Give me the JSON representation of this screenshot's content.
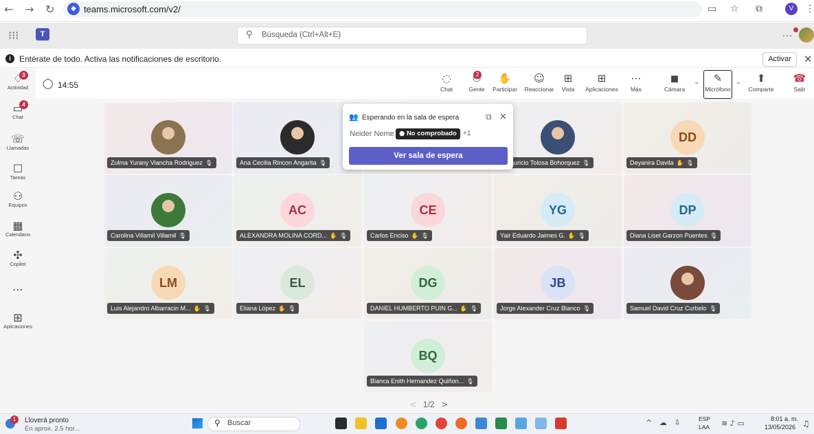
{
  "browser": {
    "url": "teams.microsoft.com/v2/",
    "profile_initial": "V"
  },
  "header": {
    "search_placeholder": "Búsqueda (Ctrl+Alt+E)"
  },
  "notification": {
    "text": "Entérate de todo. Activa las notificaciones de escritorio.",
    "button_label": "Activar"
  },
  "rail": {
    "items": [
      {
        "label": "Actividad",
        "icon": "bell-icon",
        "badge": "3"
      },
      {
        "label": "Chat",
        "icon": "chat-icon",
        "badge": "4"
      },
      {
        "label": "Llamadas",
        "icon": "phone-icon",
        "badge": ""
      },
      {
        "label": "Tareas",
        "icon": "tasks-icon",
        "badge": ""
      },
      {
        "label": "Equipos",
        "icon": "teams-icon",
        "badge": ""
      },
      {
        "label": "Calendario",
        "icon": "calendar-icon",
        "badge": ""
      },
      {
        "label": "Copilot",
        "icon": "copilot-icon",
        "badge": ""
      },
      {
        "label": "",
        "icon": "more-icon",
        "badge": ""
      },
      {
        "label": "Aplicaciones",
        "icon": "add-apps-icon",
        "badge": ""
      }
    ]
  },
  "meeting": {
    "timer": "14:55",
    "toolbar": [
      {
        "label": "Chat",
        "icon": "chat-bubble-icon"
      },
      {
        "label": "Gente",
        "icon": "people-icon",
        "badge": "2"
      },
      {
        "label": "Participar",
        "icon": "raise-hand-icon"
      },
      {
        "label": "Reaccionar",
        "icon": "smile-icon"
      },
      {
        "label": "Vista",
        "icon": "grid-view-icon"
      },
      {
        "label": "Aplicaciones",
        "icon": "add-app-icon"
      },
      {
        "label": "Más",
        "icon": "more-horizontal-icon"
      },
      {
        "label": "Cámara",
        "icon": "camera-off-icon"
      },
      {
        "label": "Micrófono",
        "icon": "mic-off-icon"
      },
      {
        "label": "Comparte",
        "icon": "share-screen-icon"
      },
      {
        "label": "Salir",
        "icon": "hang-up-icon"
      }
    ]
  },
  "participants": [
    {
      "name": "Zulma Yurany Viancha Rodriguez",
      "initials": "",
      "photo": true,
      "hand": false,
      "color": "#8a7350"
    },
    {
      "name": "Ana Cecilia Rincon Angarita",
      "initials": "",
      "photo": true,
      "hand": false,
      "color": "#2b2b2b"
    },
    {
      "name": "",
      "initials": "",
      "photo": false,
      "hand": false,
      "color": ""
    },
    {
      "name": "o Mauricio Tolosa Bohorquez",
      "initials": "",
      "photo": true,
      "hand": false,
      "color": "#3b4f74"
    },
    {
      "name": "Deyanira Davila",
      "initials": "DD",
      "photo": false,
      "hand": true,
      "color": "#f7d9b5",
      "text": "#8a4b1c"
    },
    {
      "name": "Carolina Villamil Villamil",
      "initials": "",
      "photo": true,
      "hand": false,
      "color": "#3d7a3a"
    },
    {
      "name": "ALEXANDRA MOLINA CORD...",
      "initials": "AC",
      "photo": false,
      "hand": true,
      "color": "#fbd7dc",
      "text": "#a8323f"
    },
    {
      "name": "Carlos Enciso",
      "initials": "CE",
      "photo": false,
      "hand": true,
      "color": "#fbd7dc",
      "text": "#a8323f"
    },
    {
      "name": "Yair Eduardo Jaimes G.",
      "initials": "YG",
      "photo": false,
      "hand": true,
      "color": "#d5ecf6",
      "text": "#226a8a"
    },
    {
      "name": "Diana Liset Garzon Puentes",
      "initials": "DP",
      "photo": false,
      "hand": false,
      "color": "#d5ecf6",
      "text": "#226a8a"
    },
    {
      "name": "Luis Alejandro Albarracin M...",
      "initials": "LM",
      "photo": false,
      "hand": true,
      "color": "#f7d9b5",
      "text": "#8a4b1c"
    },
    {
      "name": "Eliana López",
      "initials": "EL",
      "photo": false,
      "hand": true,
      "color": "#dbe9dd",
      "text": "#3e5b44"
    },
    {
      "name": "DANIEL HUMBERTO PUIN G...",
      "initials": "DG",
      "photo": false,
      "hand": true,
      "color": "#d3eed7",
      "text": "#2e6b3a"
    },
    {
      "name": "Jorge Alexander Cruz Blanco",
      "initials": "JB",
      "photo": false,
      "hand": false,
      "color": "#d9e3f5",
      "text": "#2d4d86"
    },
    {
      "name": "Samuel David Cruz Curbelo",
      "initials": "",
      "photo": true,
      "hand": false,
      "color": "#7a4b3a"
    },
    {
      "name": "Blanca Enith Hernandez Quiñon...",
      "initials": "BQ",
      "photo": false,
      "hand": false,
      "color": "#d3eed7",
      "text": "#2e6b3a"
    }
  ],
  "lobby": {
    "title": "Esperando en la sala de espera",
    "person": "Neider Neme",
    "badge": "No comprobado",
    "extra": "+1",
    "button": "Ver sala de espera"
  },
  "pager": {
    "text": "1/2"
  },
  "taskbar": {
    "weather_title": "Lloverá pronto",
    "weather_sub": "En aprox. 2.5 hor...",
    "weather_badge": "1",
    "search": "Buscar",
    "lang1": "ESP",
    "lang2": "LAA",
    "time": "8:01 a. m.",
    "date": "13/05/2026"
  }
}
